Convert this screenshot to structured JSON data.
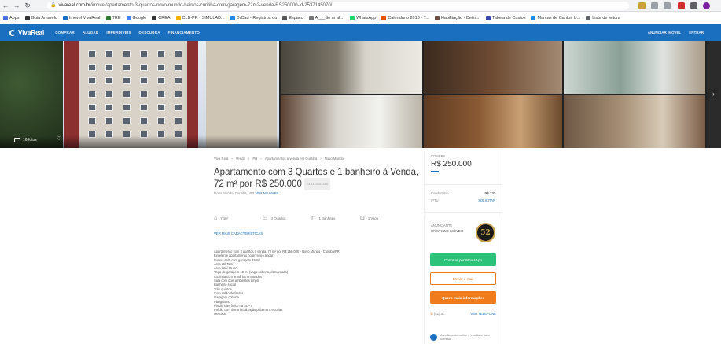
{
  "browser": {
    "url_domain": "vivareal.com.br",
    "url_path": "/imovel/apartamento-3-quartos-novo-mundo-bairros-curitiba-com-garagem-72m2-venda-RS250000-id-2537145070/"
  },
  "bookmarks": [
    {
      "label": "Apps",
      "color": "#4a6ee0"
    },
    {
      "label": "Guia Amarelo",
      "color": "#333333"
    },
    {
      "label": "Imóvel VivaReal",
      "color": "#1b6fbf"
    },
    {
      "label": "TRE",
      "color": "#2e7d32"
    },
    {
      "label": "Google",
      "color": "#4285f4"
    },
    {
      "label": "CREA",
      "color": "#333333"
    },
    {
      "label": "CLB-PR - SIMULAD...",
      "color": "#f4b400"
    },
    {
      "label": "DrCad - Registros ou",
      "color": "#1e88e5"
    },
    {
      "label": "Espaço",
      "color": "#555555"
    },
    {
      "label": "A___Se m ali...",
      "color": "#777777"
    },
    {
      "label": "WhatsApp",
      "color": "#25d366"
    },
    {
      "label": "Calendário 2018 - T...",
      "color": "#e65100"
    },
    {
      "label": "Habilitação - Detra...",
      "color": "#6d4c41"
    },
    {
      "label": "Tabela de Custos",
      "color": "#3949ab"
    },
    {
      "label": "Marcas de Cantos U...",
      "color": "#1e88e5"
    },
    {
      "label": "Lista de leitura",
      "color": "#5f6368"
    }
  ],
  "site": {
    "logo": "VivaReal",
    "nav": [
      "COMPRAR",
      "ALUGAR",
      "IMPERDÍVEIS",
      "DESCUBRA",
      "FINANCIAMENTO"
    ],
    "right_nav": [
      "ANUNCIAR IMÓVEL",
      "ENTRAR"
    ]
  },
  "gallery": {
    "photo_count": "16 fotos"
  },
  "breadcrumbs": [
    "Viva Real",
    "Venda",
    "PR",
    "Apartamentos a venda em Curitiba",
    "Novo Mundo"
  ],
  "listing": {
    "title": "Apartamento com 3 Quartos e 1 banheiro à Venda, 72 m² por R$ 250.000",
    "badge": "COD. 2537145",
    "address": "Novo Mundo, Curitiba - PR",
    "map_link": "VER NO MAPA",
    "amenities": [
      {
        "icon": "area-icon",
        "label": "72m²"
      },
      {
        "icon": "bed-icon",
        "label": "3 Quartos"
      },
      {
        "icon": "bath-icon",
        "label": "1 Banheiro"
      },
      {
        "icon": "car-icon",
        "label": "1 Vaga"
      }
    ],
    "tour_link": "VER MAIS CARACTERÍSTICAS",
    "description": [
      "Apartamento com 3 quartos à venda, 72 m² por R$ 250.000 - Novo Mundo - Curitiba/PR",
      "Excelente apartamento no primeiro andar",
      "Possui sala com garagem 45 m²",
      "Área útil 72m²",
      "Área total 81 m²",
      "Vaga de garagem 10 m² (vaga coberta, demarcada)",
      "Cozinha com armários embutidos",
      "Sala com dois ambientes ampla",
      "Banheiro social",
      "Três quartos",
      "Com salão de festas",
      "Garagem coberta",
      "Playground",
      "Portão Eletrônico na SLPT",
      "Prédio com ótima localização próximo a escolas",
      "Mercado"
    ]
  },
  "sidebar": {
    "price_label": "COMPRA",
    "price": "R$ 250.000",
    "costs": [
      {
        "label": "Condomínio",
        "value": "R$ 230"
      },
      {
        "label": "IPTU",
        "value": "SOLICITAR"
      }
    ],
    "advertiser_label": "ANUNCIANTE",
    "advertiser_name": "CRISTIANO IMÓVEIS",
    "advertiser_logo": "52",
    "whatsapp_button": "Contatar por WhatsApp",
    "send_message_button": "Enviar e-mail",
    "more_info_button": "Quero mais informações",
    "phone": "(41) 3...",
    "see_phone": "VER TELEFONE",
    "chat_text": "Atendimento online e imediato pelo corretor"
  }
}
